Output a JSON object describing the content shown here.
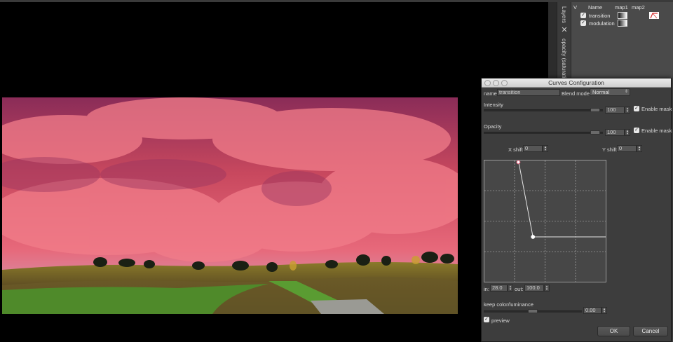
{
  "layers_panel": {
    "tab_label": "Layers",
    "side_tab_label": "opacity (saturation)",
    "close_glyph": "✕",
    "columns": {
      "v": "V",
      "name": "Name",
      "map1": "map1",
      "map2": "map2"
    },
    "rows": [
      {
        "name": "transition",
        "checked": true
      },
      {
        "name": "modulation",
        "checked": true
      }
    ]
  },
  "dialog": {
    "title": "Curves Configuration",
    "name_label": "name:",
    "name_value": "transition",
    "blend_label": "Blend mode:",
    "blend_value": "Normal",
    "intensity": {
      "label": "Intensity",
      "value": "100",
      "mask_label": "Enable mask",
      "mask_checked": true,
      "level": 1.0
    },
    "opacity": {
      "label": "Opacity",
      "value": "100",
      "mask_label": "Enable mask",
      "mask_checked": true,
      "level": 1.0
    },
    "x_shift_label": "X shift",
    "x_shift_value": "0",
    "y_shift_label": "Y shift",
    "y_shift_value": "0",
    "curve_points": [
      {
        "in": 28.0,
        "out": 100.0
      },
      {
        "in": 40.0,
        "out": 37.0
      },
      {
        "in": 100.0,
        "out": 37.0
      }
    ],
    "in_label": "in:",
    "in_value": "28.0",
    "out_label": "out:",
    "out_value": "100.0",
    "keep_label": "keep color/luminance",
    "keep_value": "0.00",
    "preview_label": "preview",
    "preview_checked": true,
    "ok_label": "OK",
    "cancel_label": "Cancel"
  },
  "colors": {
    "sky_pink": "#e45c72",
    "sky_purple": "#7a2a55",
    "dialog_bg": "#3d3d3d",
    "panel_bg": "#4a4a4a",
    "curve_point_selected": "#e05070"
  }
}
